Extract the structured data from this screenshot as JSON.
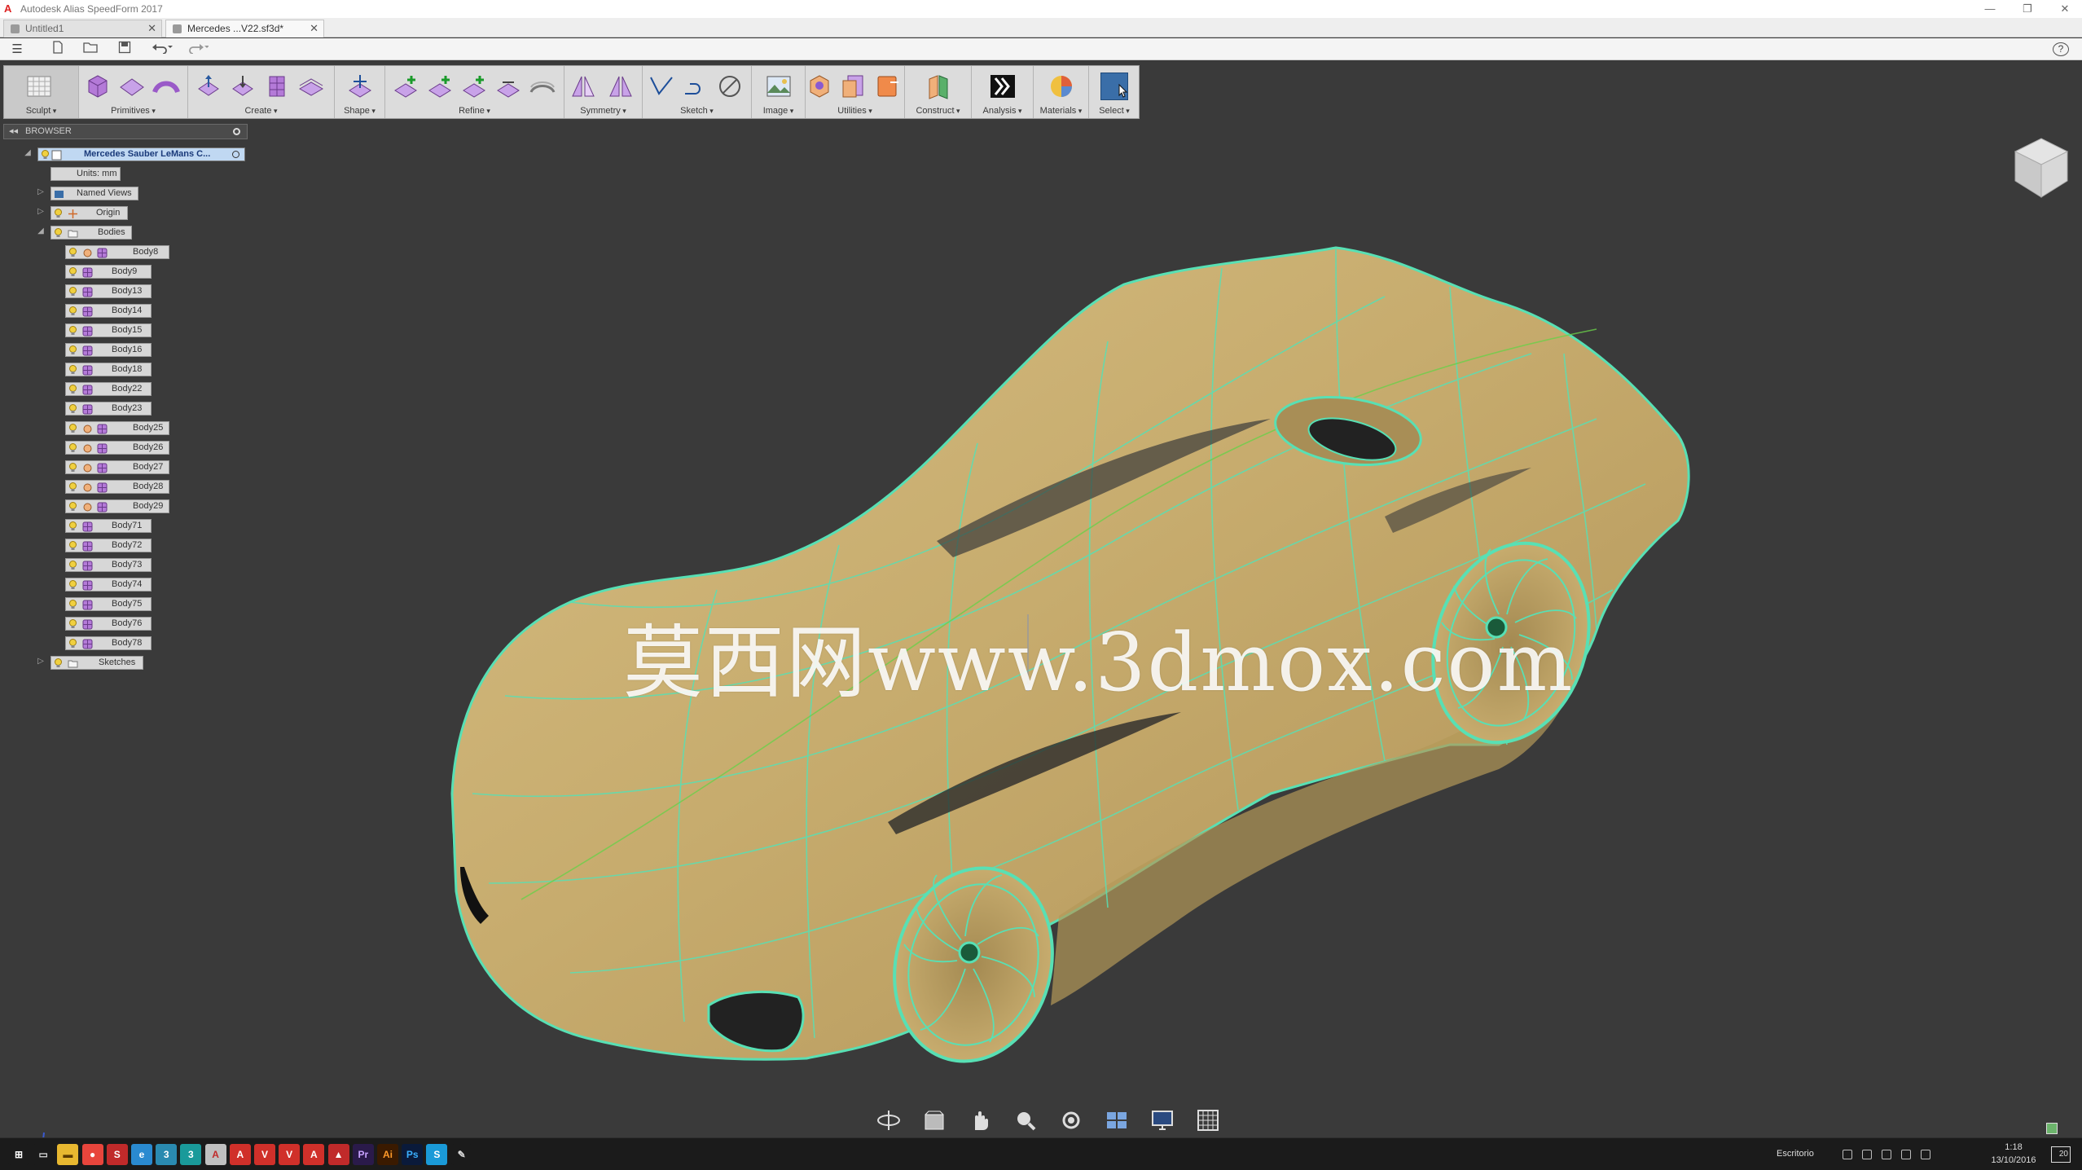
{
  "window": {
    "title": "Autodesk Alias SpeedForm 2017",
    "controls": {
      "minimize": "—",
      "restore": "❐",
      "close": "✕"
    }
  },
  "tabs": [
    {
      "label": "Untitled1",
      "close": "✕"
    },
    {
      "label": "Mercedes ...V22.sf3d*",
      "close": "✕"
    }
  ],
  "quick_access": {
    "menu": "☰",
    "help": "?"
  },
  "ribbon": {
    "groups": [
      {
        "label": "Sculpt"
      },
      {
        "label": "Primitives"
      },
      {
        "label": "Create"
      },
      {
        "label": "Shape"
      },
      {
        "label": "Refine"
      },
      {
        "label": "Symmetry"
      },
      {
        "label": "Sketch"
      },
      {
        "label": "Image"
      },
      {
        "label": "Utilities"
      },
      {
        "label": "Construct"
      },
      {
        "label": "Analysis"
      },
      {
        "label": "Materials"
      },
      {
        "label": "Select"
      }
    ]
  },
  "browser": {
    "title": "BROWSER",
    "collapse": "◂◂",
    "root": "Mercedes Sauber LeMans C...",
    "units": "Units: mm",
    "named_views": "Named Views",
    "origin": "Origin",
    "bodies_folder": "Bodies",
    "bodies": [
      "Body8",
      "Body9",
      "Body13",
      "Body14",
      "Body15",
      "Body16",
      "Body18",
      "Body22",
      "Body23",
      "Body25",
      "Body26",
      "Body27",
      "Body28",
      "Body29",
      "Body71",
      "Body72",
      "Body73",
      "Body74",
      "Body75",
      "Body76",
      "Body78"
    ],
    "sketches": "Sketches"
  },
  "viewport": {
    "watermark": "莫西网www.3dmox.com",
    "colors": {
      "body": "#c7ac6e",
      "edges": "#58e0b4",
      "background": "#3a3a3a"
    }
  },
  "taskbar": {
    "tray_label": "Escritorio",
    "time": "1:18",
    "date": "13/10/2016",
    "notification_count": "20",
    "apps": [
      "windows-start",
      "task-view",
      "file-explorer",
      "chrome",
      "stingray",
      "edge-ie",
      "3dsmax-blue",
      "3dsmax-teal",
      "autodesk-alias",
      "acrobat",
      "vray",
      "vray-next",
      "adobe-cc",
      "autocad",
      "premiere",
      "illustrator",
      "photoshop",
      "skype",
      "paint"
    ]
  }
}
